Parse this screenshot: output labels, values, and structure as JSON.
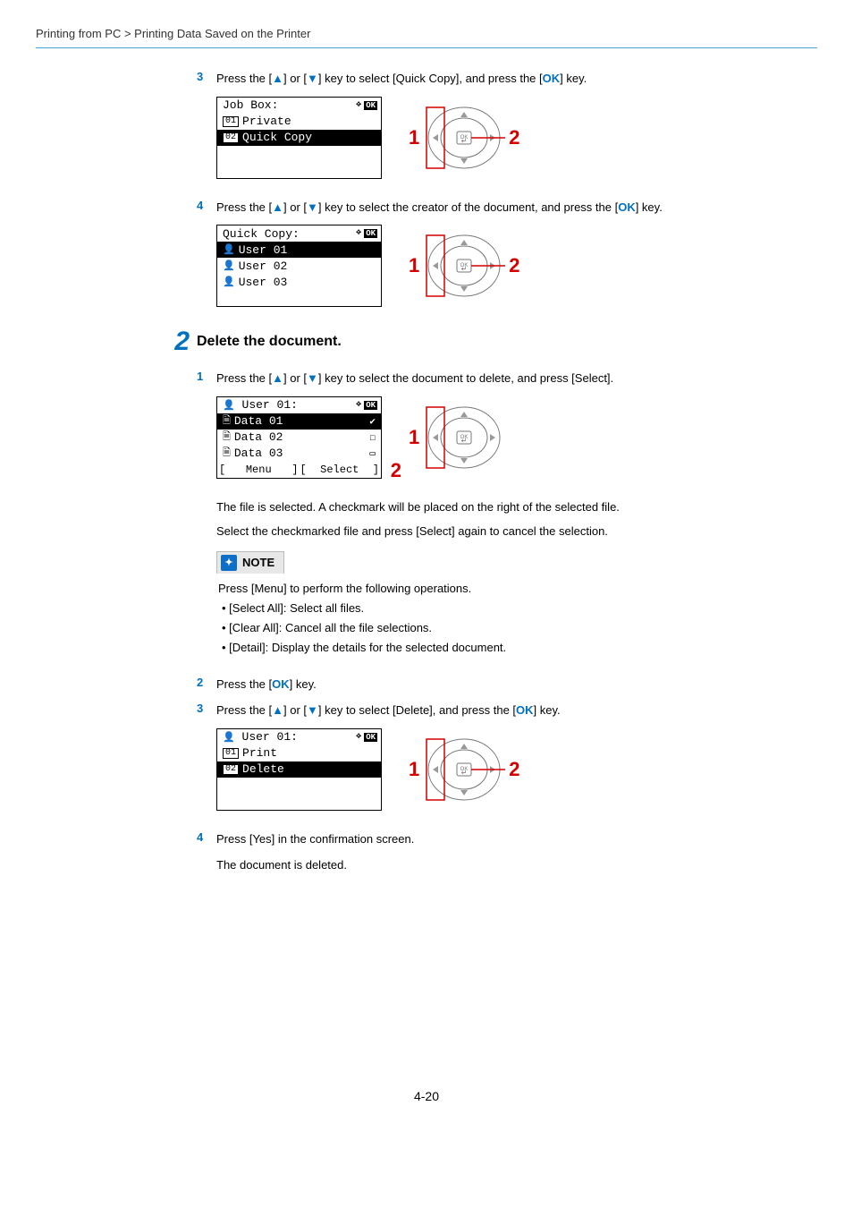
{
  "breadcrumb": "Printing from PC > Printing Data Saved on the Printer",
  "s1": {
    "step3": {
      "num": "3",
      "text_pre": "Press the [",
      "text_mid1": "] or [",
      "text_mid2": "] key to select [Quick Copy], and press the [",
      "ok": "OK",
      "text_end": "] key."
    },
    "lcd3": {
      "title": "Job Box:",
      "r1_num": "01",
      "r1_label": "Private",
      "r2_num": "02",
      "r2_label": "Quick Copy"
    },
    "step4": {
      "num": "4",
      "text_pre": "Press the [",
      "text_mid1": "] or [",
      "text_mid2": "] key to select the creator of the document, and press the [",
      "ok": "OK",
      "text_end": "] key."
    },
    "lcd4": {
      "title": "Quick Copy:",
      "u1": "User 01",
      "u2": "User 02",
      "u3": "User 03"
    }
  },
  "section2": {
    "num": "2",
    "title": "Delete the document.",
    "step1": {
      "num": "1",
      "text_pre": "Press the [",
      "text_mid1": "] or [",
      "text_mid2": "] key to select the document to delete, and press [Select]."
    },
    "lcd1": {
      "title": "User 01:",
      "d1": "Data 01",
      "d2": "Data 02",
      "d3": "Data 03",
      "menu": "Menu",
      "select": "Select"
    },
    "p1": "The file is selected. A checkmark will be placed on the right of the selected file.",
    "p2": "Select the checkmarked file and press [Select] again to cancel the selection.",
    "note": {
      "head": "NOTE",
      "intro": "Press [Menu] to perform the following operations.",
      "b1": "• [Select All]: Select all files.",
      "b2": "• [Clear All]: Cancel all the file selections.",
      "b3": "• [Detail]: Display the details for the selected document."
    },
    "step2": {
      "num": "2",
      "text_pre": "Press the [",
      "ok": "OK",
      "text_end": "] key."
    },
    "step3": {
      "num": "3",
      "text_pre": "Press the [",
      "text_mid1": "] or [",
      "text_mid2": "] key to select [Delete], and press the [",
      "ok": "OK",
      "text_end": "] key."
    },
    "lcd3": {
      "title": "User 01:",
      "r1_num": "01",
      "r1_label": "Print",
      "r2_num": "02",
      "r2_label": "Delete"
    },
    "step4": {
      "num": "4",
      "text": "Press [Yes] in the confirmation screen.",
      "p": "The document is deleted."
    }
  },
  "callouts": {
    "one": "1",
    "two": "2"
  },
  "page_num": "4-20"
}
